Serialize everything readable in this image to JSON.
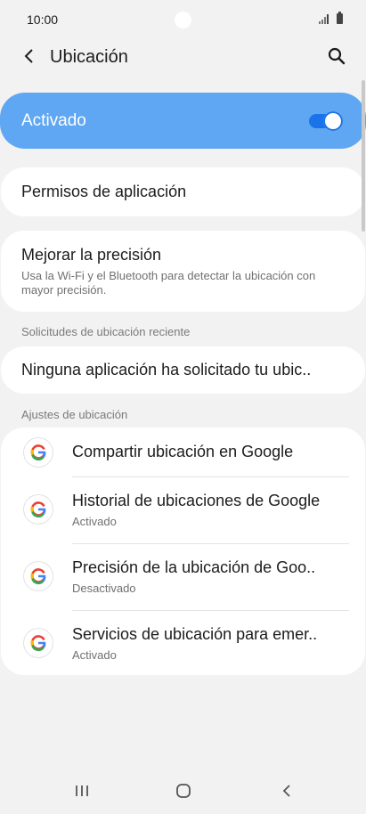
{
  "status_bar": {
    "time": "10:00"
  },
  "header": {
    "title": "Ubicación"
  },
  "master_switch": {
    "label": "Activado",
    "on": true
  },
  "permissions": {
    "label": "Permisos de aplicación"
  },
  "improve_accuracy": {
    "title": "Mejorar la precisión",
    "description": "Usa la Wi-Fi y el Bluetooth para detectar la ubicación con mayor precisión."
  },
  "recent_requests": {
    "header": "Solicitudes de ubicación reciente",
    "item": "Ninguna aplicación ha solicitado tu ubic.."
  },
  "location_settings": {
    "header": "Ajustes de ubicación",
    "items": [
      {
        "title": "Compartir ubicación en Google",
        "subtitle": ""
      },
      {
        "title": "Historial de ubicaciones de Google",
        "subtitle": "Activado"
      },
      {
        "title": "Precisión de la ubicación de Goo..",
        "subtitle": "Desactivado"
      },
      {
        "title": "Servicios de ubicación para emer..",
        "subtitle": "Activado"
      }
    ]
  },
  "colors": {
    "accent": "#5fa7f2",
    "toggle": "#1a73e8",
    "background": "#f2f2f2"
  }
}
